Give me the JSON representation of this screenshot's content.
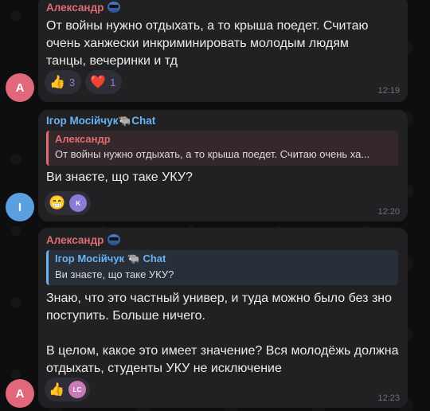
{
  "messages": [
    {
      "sender": "Александр",
      "sender_color": "#e06c72",
      "avatar_letter": "А",
      "avatar_color": "#e0687a",
      "text_lines": [
        "От войны нужно отдыхать, а то крыша поедет. Считаю",
        "очень ханжески инкриминировать молодым людям",
        "танцы, вечеринки и тд"
      ],
      "reactions": [
        {
          "emoji": "👍",
          "count": "3"
        },
        {
          "emoji": "❤️",
          "count": "1"
        }
      ],
      "time": "12:19"
    },
    {
      "sender": "Ігор Мосійчук🐃Chat",
      "sender_color": "#6ab2f2",
      "avatar_letter": "І",
      "avatar_color": "#5aa0e0",
      "quote": {
        "sender": "Александр",
        "text": "От войны нужно отдыхать, а то крыша поедет. Считаю очень ха...",
        "color": "#e06c72"
      },
      "text_lines": [
        "Ви знаєте, що таке УКУ?"
      ],
      "reactions": [
        {
          "emoji": "😁",
          "reactor": "K"
        }
      ],
      "time": "12:20"
    },
    {
      "sender": "Александр",
      "sender_color": "#e06c72",
      "avatar_letter": "А",
      "avatar_color": "#e0687a",
      "quote": {
        "sender": "Ігор Мосійчук 🐃 Chat",
        "text": "Ви знаєте, що таке УКУ?",
        "color": "#6ab2f2"
      },
      "text_lines": [
        "Знаю, что это частный универ, и туда можно было без зно",
        "поступить. Больше ничего.",
        "",
        "В целом, какое это имеет значение? Вся молодёжь должна",
        "отдыхать, студенты УКУ не исключение"
      ],
      "reactions": [
        {
          "emoji": "👍",
          "reactor": "LC"
        }
      ],
      "time": "12:23"
    }
  ]
}
